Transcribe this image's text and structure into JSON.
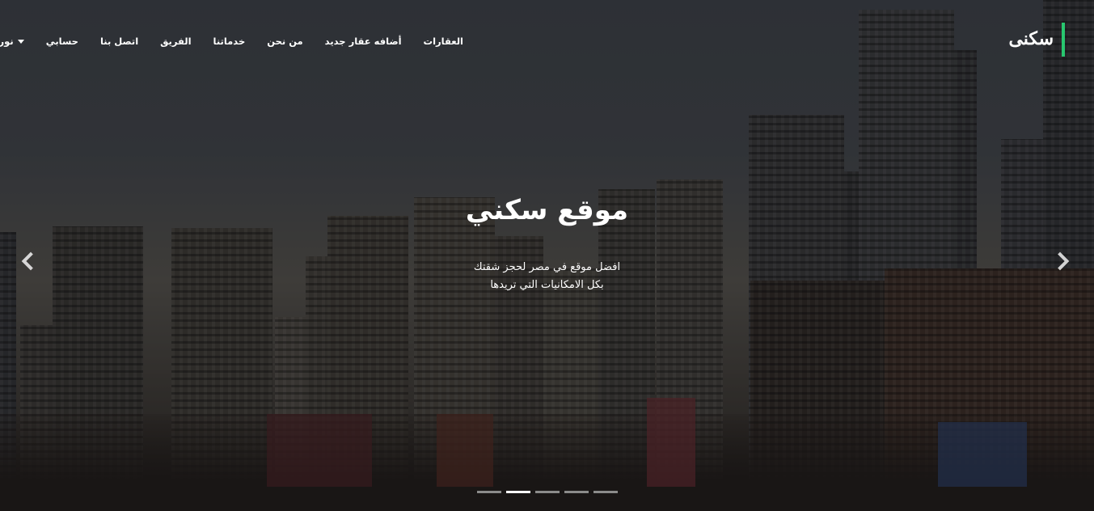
{
  "brand": {
    "name": "سكنى",
    "accent_color": "#28c76f"
  },
  "nav": {
    "items": [
      {
        "label": "العقارات"
      },
      {
        "label": "أضافه عقار جديد"
      },
      {
        "label": "من نحن"
      },
      {
        "label": "خدماتنا"
      },
      {
        "label": "الفريق"
      },
      {
        "label": "اتصل بنا"
      },
      {
        "label": "حسابي"
      }
    ],
    "user": {
      "label": "نور الشريف",
      "icon": "caret-down-icon"
    }
  },
  "hero": {
    "title": "موقع سكني",
    "subtitle_line1": "افضل موقع في مصر لحجز شقتك",
    "subtitle_line2": "بكل الامكانيات التي تريدها"
  },
  "carousel": {
    "prev_icon": "chevron-left-icon",
    "next_icon": "chevron-right-icon",
    "slide_count": 5,
    "active_index": 1
  }
}
